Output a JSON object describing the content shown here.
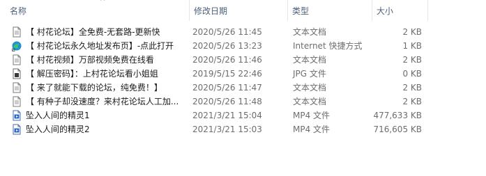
{
  "columns": {
    "name": "名称",
    "date": "修改日期",
    "type": "类型",
    "size": "大小"
  },
  "sort_indicator": "^",
  "files": [
    {
      "name": "【 村花论坛】全免费-无套路-更新快",
      "date": "2020/5/26 11:45",
      "type": "文本文档",
      "size": "2 KB",
      "icon": "text-document-icon"
    },
    {
      "name": "【 村花论坛永久地址发布页】-点此打开",
      "date": "2020/5/26 13:23",
      "type": "Internet 快捷方式",
      "size": "1 KB",
      "icon": "internet-shortcut-icon"
    },
    {
      "name": "【 村花视频】万部视频免费在线看",
      "date": "2020/5/26 11:46",
      "type": "文本文档",
      "size": "2 KB",
      "icon": "text-document-icon"
    },
    {
      "name": "【 解压密码】：上村花论坛看小姐姐",
      "date": "2019/5/15 22:46",
      "type": "JPG 文件",
      "size": "0 KB",
      "icon": "image-file-icon"
    },
    {
      "name": "【 来了就能下载的论坛，纯免费！】",
      "date": "2020/5/26 11:47",
      "type": "文本文档",
      "size": "2 KB",
      "icon": "text-document-icon"
    },
    {
      "name": "【 有种子却没速度？来村花论坛人工加...",
      "date": "2020/5/26 11:48",
      "type": "文本文档",
      "size": "2 KB",
      "icon": "text-document-icon"
    },
    {
      "name": "坠入人间的精灵1",
      "date": "2021/3/21 15:04",
      "type": "MP4 文件",
      "size": "477,633 KB",
      "icon": "video-file-icon"
    },
    {
      "name": "坠入人间的精灵2",
      "date": "2021/3/21 15:03",
      "type": "MP4 文件",
      "size": "716,605 KB",
      "icon": "video-file-icon"
    }
  ]
}
